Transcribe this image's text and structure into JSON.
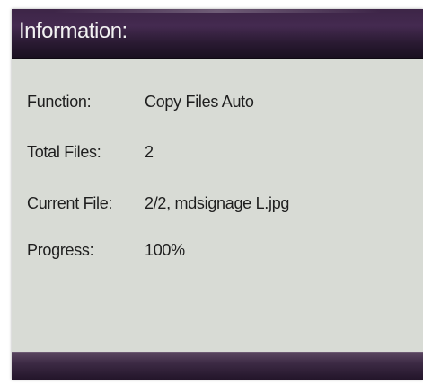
{
  "dialog": {
    "title": "Information:",
    "rows": [
      {
        "label": "Function:",
        "value": "Copy Files Auto"
      },
      {
        "label": "Total Files:",
        "value": "2"
      },
      {
        "label": "Current File:",
        "value": "2/2, mdsignage L.jpg"
      },
      {
        "label": "Progress:",
        "value": "100%"
      }
    ]
  },
  "colors": {
    "title_bar": "#3d2547",
    "panel_background": "#d8dbd5",
    "title_text": "#f2f2f2",
    "body_text": "#1e1e1e"
  }
}
